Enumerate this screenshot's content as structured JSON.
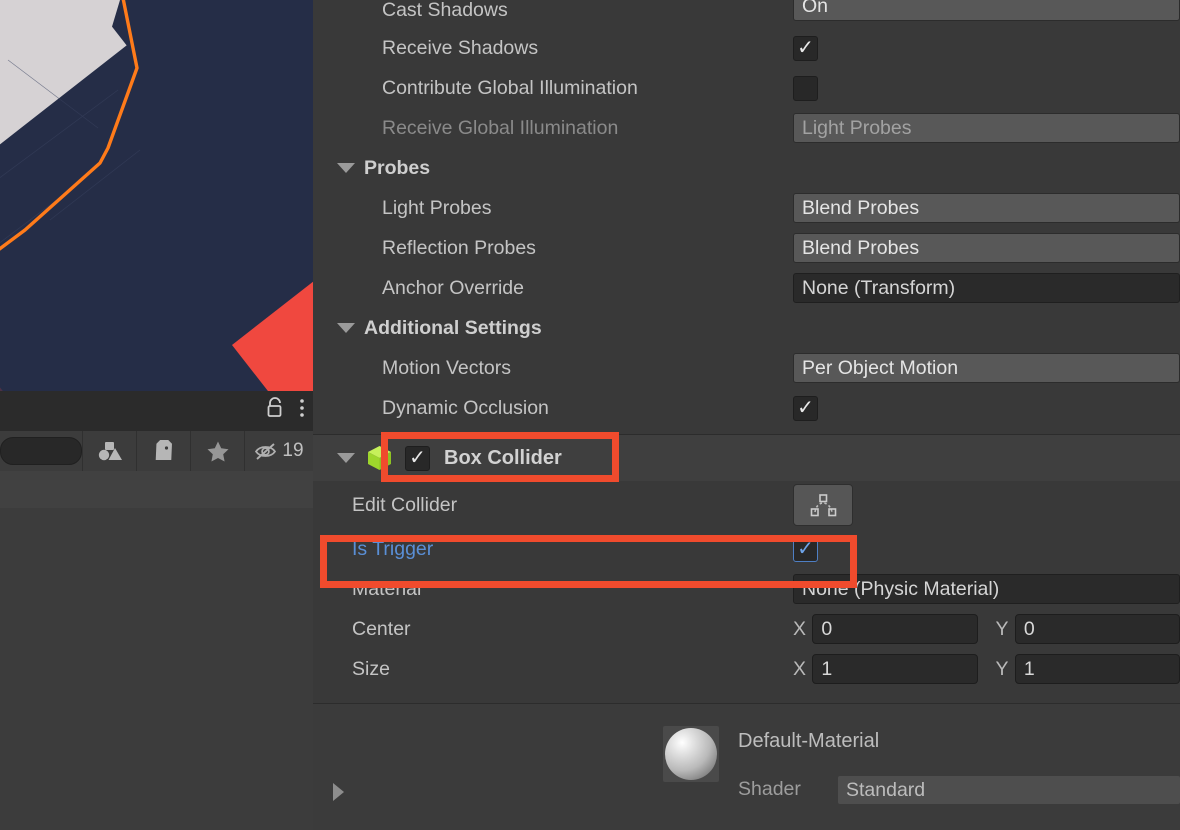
{
  "app": "Unity Editor Inspector",
  "scene": {
    "colors": {
      "floor": "#4b3146",
      "object": "#252d47",
      "object_shadow": "#20263c",
      "highlight_outline": "#ff7b1a",
      "white_face": "#d6d2d4",
      "red_face": "#f0483f"
    }
  },
  "hierarchy_toolbar": {
    "lock_icon": "lock-icon",
    "menu_icon": "kebab-menu-icon",
    "search_value": "",
    "search_placeholder": "",
    "buttons": [
      {
        "icon": "shapes-filter-icon",
        "label": ""
      },
      {
        "icon": "tag-icon",
        "label": ""
      },
      {
        "icon": "star-favorite-icon",
        "label": ""
      },
      {
        "icon": "hidden-eye-icon",
        "label": "19"
      }
    ]
  },
  "inspector": {
    "renderer_rows": [
      {
        "label": "Cast Shadows",
        "type": "popup",
        "value": "On",
        "dim": false,
        "clipped": true
      },
      {
        "label": "Receive Shadows",
        "type": "checkbox",
        "value": true,
        "dim": false
      },
      {
        "label": "Contribute Global Illumination",
        "type": "checkbox",
        "value": false,
        "dim": false
      },
      {
        "label": "Receive Global Illumination",
        "type": "popup",
        "value": "Light Probes",
        "dim": true
      }
    ],
    "probes_section": {
      "title": "Probes",
      "expanded": true,
      "rows": [
        {
          "label": "Light Probes",
          "type": "popup",
          "value": "Blend Probes"
        },
        {
          "label": "Reflection Probes",
          "type": "popup",
          "value": "Blend Probes"
        },
        {
          "label": "Anchor Override",
          "type": "objectfield",
          "value": "None (Transform)"
        }
      ]
    },
    "additional_section": {
      "title": "Additional Settings",
      "expanded": true,
      "rows": [
        {
          "label": "Motion Vectors",
          "type": "popup",
          "value": "Per Object Motion"
        },
        {
          "label": "Dynamic Occlusion",
          "type": "checkbox",
          "value": true
        }
      ]
    },
    "box_collider": {
      "title": "Box Collider",
      "icon": "box-collider-cube-icon",
      "icon_color": "#a4e039",
      "expanded": true,
      "enabled": true,
      "highlighted": true,
      "edit_collider": {
        "label": "Edit Collider",
        "icon": "edit-collider-icon"
      },
      "is_trigger": {
        "label": "Is Trigger",
        "value": true,
        "highlighted": true
      },
      "material": {
        "label": "Material",
        "value": "None (Physic Material)"
      },
      "center": {
        "label": "Center",
        "x_axis": "X",
        "x": "0",
        "y_axis": "Y",
        "y": "0"
      },
      "size": {
        "label": "Size",
        "x_axis": "X",
        "x": "1",
        "y_axis": "Y",
        "y": "1"
      }
    },
    "material_preview": {
      "name": "Default-Material",
      "shader_label": "Shader",
      "shader_value": "Standard",
      "expanded": false,
      "preview_icon": "material-sphere-preview"
    }
  },
  "annotations": {
    "highlight_color": "#f04b2d",
    "boxes": [
      "box-collider-header",
      "is-trigger-row"
    ]
  }
}
